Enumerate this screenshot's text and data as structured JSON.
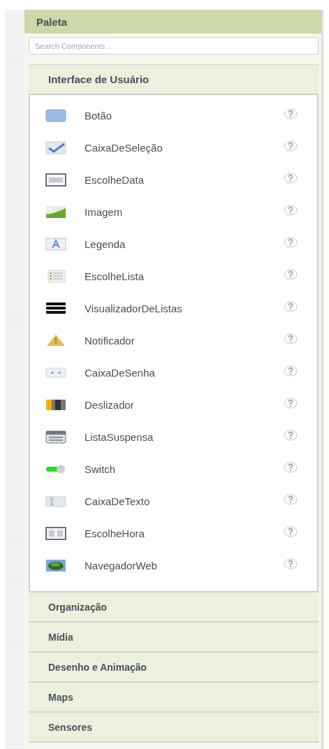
{
  "palette": {
    "title": "Paleta",
    "search": {
      "placeholder": "Search Components..."
    },
    "categories": [
      {
        "label": "Interface de Usuário",
        "expanded": true,
        "items": [
          {
            "label": "Botão",
            "kind": "button"
          },
          {
            "label": "CaixaDeSeleção",
            "kind": "checkbox"
          },
          {
            "label": "EscolheData",
            "kind": "datepicker"
          },
          {
            "label": "Imagem",
            "kind": "image"
          },
          {
            "label": "Legenda",
            "kind": "label"
          },
          {
            "label": "EscolheLista",
            "kind": "listpicker"
          },
          {
            "label": "VisualizadorDeListas",
            "kind": "listview"
          },
          {
            "label": "Notificador",
            "kind": "notifier"
          },
          {
            "label": "CaixaDeSenha",
            "kind": "password"
          },
          {
            "label": "Deslizador",
            "kind": "slider"
          },
          {
            "label": "ListaSuspensa",
            "kind": "spinner"
          },
          {
            "label": "Switch",
            "kind": "switch"
          },
          {
            "label": "CaixaDeTexto",
            "kind": "textbox"
          },
          {
            "label": "EscolheHora",
            "kind": "timepicker"
          },
          {
            "label": "NavegadorWeb",
            "kind": "webviewer"
          }
        ]
      },
      {
        "label": "Organização",
        "expanded": false
      },
      {
        "label": "Mídia",
        "expanded": false
      },
      {
        "label": "Desenho e Animação",
        "expanded": false
      },
      {
        "label": "Maps",
        "expanded": false
      },
      {
        "label": "Sensores",
        "expanded": false
      }
    ]
  }
}
